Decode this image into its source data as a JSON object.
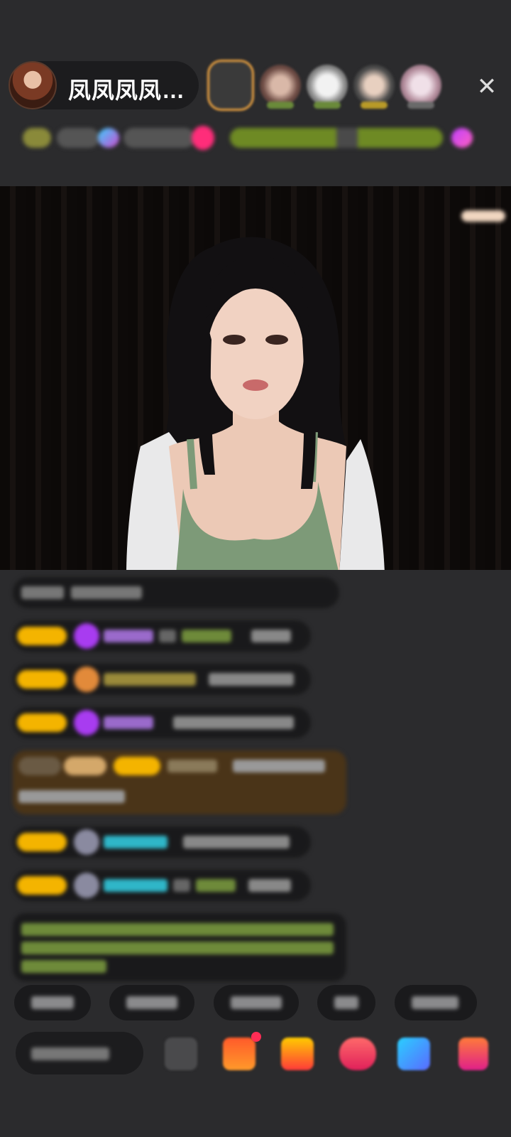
{
  "header": {
    "host_name": "凤凤凤凤…",
    "close_symbol": "✕",
    "icons": {
      "avatar": "host-avatar",
      "close": "close-icon"
    }
  },
  "colors": {
    "background": "#2b2b2d",
    "gold_badge": "#f4b400",
    "purple_gem": "#a83cf0",
    "green_text": "#8fb44a",
    "cyan_name": "#2fb6c8",
    "red_accent": "#ff2d55"
  },
  "toolbar": {
    "icons": [
      "emoji-icon",
      "gift-box-icon",
      "treasure-icon",
      "game-icon",
      "chat-bubble-icon",
      "shop-icon"
    ]
  }
}
